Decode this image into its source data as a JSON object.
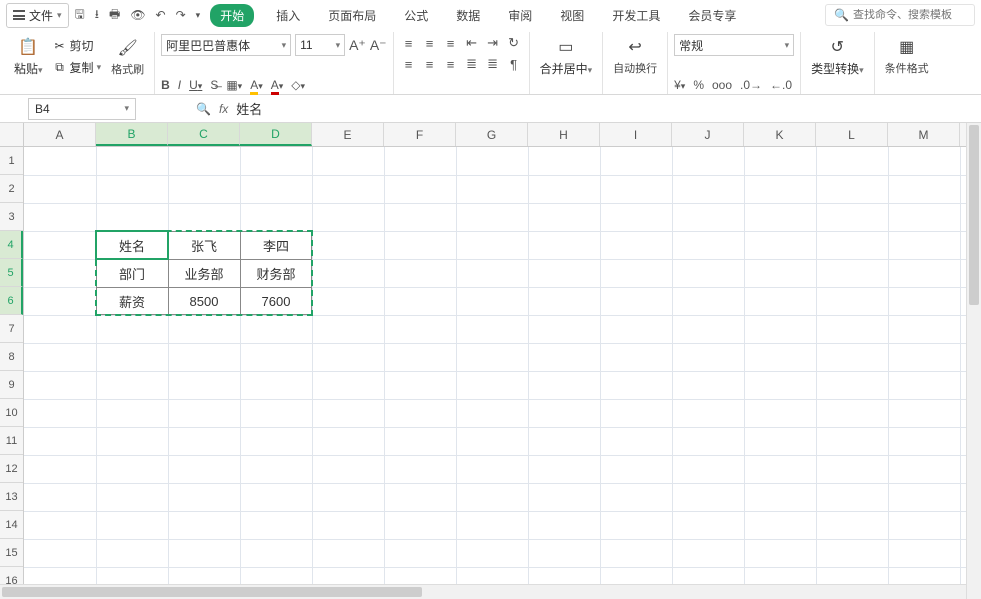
{
  "menu": {
    "file": "文件"
  },
  "tabs": {
    "start": "开始",
    "insert": "插入",
    "layout": "页面布局",
    "formula": "公式",
    "data": "数据",
    "review": "审阅",
    "view": "视图",
    "dev": "开发工具",
    "member": "会员专享"
  },
  "search_placeholder": "查找命令、搜索模板",
  "ribbon": {
    "paste": "粘贴",
    "cut": "剪切",
    "copy": "复制",
    "format_painter": "格式刷",
    "font_name": "阿里巴巴普惠体",
    "font_size": "11",
    "merge": "合并居中",
    "wrap": "自动换行",
    "number_format": "常规",
    "type_convert": "类型转换",
    "cond_format": "条件格式"
  },
  "namebox": "B4",
  "formula_value": "姓名",
  "columns": [
    "A",
    "B",
    "C",
    "D",
    "E",
    "F",
    "G",
    "H",
    "I",
    "J",
    "K",
    "L",
    "M"
  ],
  "rows": [
    "1",
    "2",
    "3",
    "4",
    "5",
    "6",
    "7",
    "8",
    "9",
    "10",
    "11",
    "12",
    "13",
    "14",
    "15",
    "16"
  ],
  "sel_cols": [
    1,
    2,
    3
  ],
  "sel_rows": [
    3,
    4,
    5
  ],
  "table": {
    "r4": {
      "B": "姓名",
      "C": "张飞",
      "D": "李四"
    },
    "r5": {
      "B": "部门",
      "C": "业务部",
      "D": "财务部"
    },
    "r6": {
      "B": "薪资",
      "C": "8500",
      "D": "7600"
    }
  }
}
